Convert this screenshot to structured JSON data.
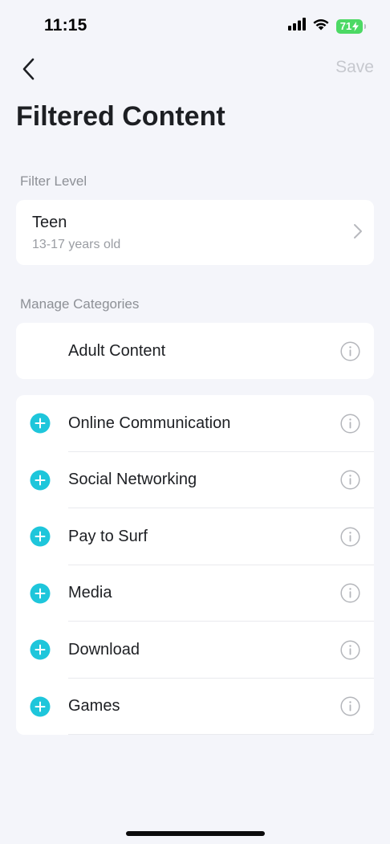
{
  "status_bar": {
    "time": "11:15",
    "battery": "71",
    "icons": [
      "cellular-signal-icon",
      "wifi-icon",
      "battery-charging-icon"
    ]
  },
  "nav": {
    "back_icon": "chevron-left-icon",
    "save_label": "Save"
  },
  "page": {
    "title": "Filtered Content"
  },
  "filter_level": {
    "section_label": "Filter Level",
    "title": "Teen",
    "subtitle": "13-17 years old",
    "icon": "chevron-right-icon"
  },
  "manage": {
    "section_label": "Manage Categories",
    "blocked": [
      {
        "label": "Adult Content"
      }
    ],
    "categories": [
      {
        "label": "Online Communication"
      },
      {
        "label": "Social Networking"
      },
      {
        "label": "Pay to Surf"
      },
      {
        "label": "Media"
      },
      {
        "label": "Download"
      },
      {
        "label": "Games"
      }
    ]
  },
  "colors": {
    "accent": "#1ec6db",
    "background": "#f4f5fa",
    "disabled_text": "#c6c8ce",
    "battery": "#4cd964"
  }
}
